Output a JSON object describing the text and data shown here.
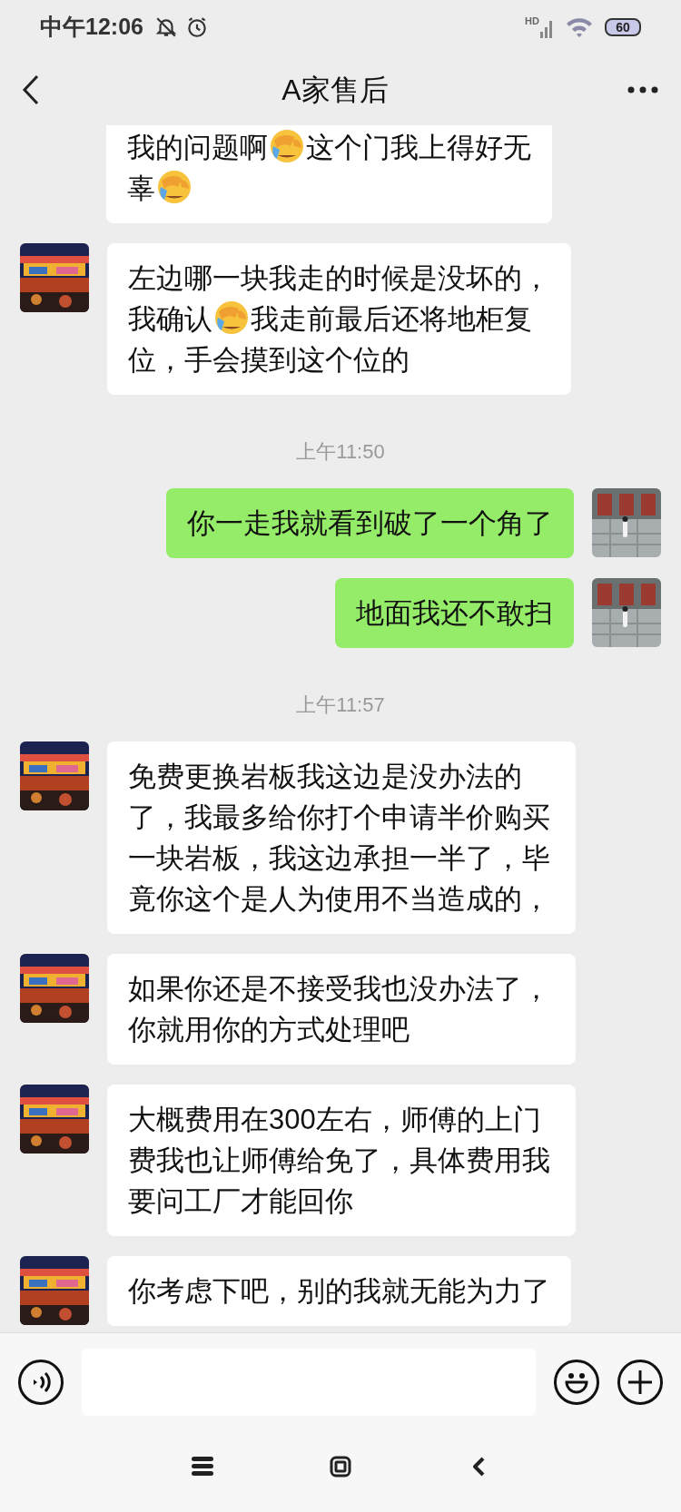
{
  "status_bar": {
    "time": "中午12:06",
    "network": "HD",
    "battery": "60"
  },
  "header": {
    "title": "A家售后"
  },
  "messages": [
    {
      "kind": "incoming",
      "cut": true,
      "parts": [
        {
          "kind": "text",
          "text": "我的问题啊"
        },
        {
          "kind": "emoji"
        },
        {
          "kind": "text",
          "text": "这个门我上得好无"
        },
        {
          "kind": "break"
        },
        {
          "kind": "text",
          "text": "辜"
        },
        {
          "kind": "emoji"
        }
      ]
    },
    {
      "kind": "incoming",
      "parts": [
        {
          "kind": "text",
          "text": "左边哪一块我走的时候是没坏的，"
        },
        {
          "kind": "break"
        },
        {
          "kind": "text",
          "text": "我确认"
        },
        {
          "kind": "emoji"
        },
        {
          "kind": "text",
          "text": "我走前最后还将地柜复"
        },
        {
          "kind": "break"
        },
        {
          "kind": "text",
          "text": "位，手会摸到这个位的"
        }
      ]
    },
    {
      "kind": "time",
      "text": "上午11:50"
    },
    {
      "kind": "outgoing",
      "parts": [
        {
          "kind": "text",
          "text": "你一走我就看到破了一个角了"
        }
      ]
    },
    {
      "kind": "outgoing",
      "parts": [
        {
          "kind": "text",
          "text": "地面我还不敢扫"
        }
      ]
    },
    {
      "kind": "time",
      "text": "上午11:57"
    },
    {
      "kind": "incoming",
      "parts": [
        {
          "kind": "text",
          "text": "免费更换岩板我这边是没办法的了，我最多给你打个申请半价购买一块岩板，我这边承担一半了，毕竟你这个是人为使用不当造成的，"
        }
      ]
    },
    {
      "kind": "incoming",
      "parts": [
        {
          "kind": "text",
          "text": "如果你还是不接受我也没办法了，你就用你的方式处理吧"
        }
      ]
    },
    {
      "kind": "incoming",
      "parts": [
        {
          "kind": "text",
          "text": "大概费用在300左右，师傅的上门费我也让师傅给免了，具体费用我要问工厂才能回你"
        }
      ]
    },
    {
      "kind": "incoming",
      "parts": [
        {
          "kind": "text",
          "text": "你考虑下吧，别的我就无能为力了"
        }
      ]
    }
  ]
}
